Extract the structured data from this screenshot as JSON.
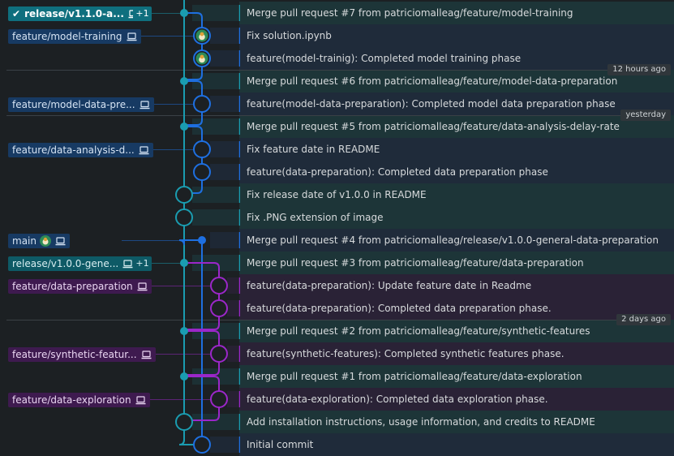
{
  "colors": {
    "background": "#1c2023",
    "lane_teal": "#1a9cb0",
    "lane_blue": "#1e6fe0",
    "lane_purple": "#9b27c9",
    "pill_teal_bg": "#0e5a66",
    "pill_blue_bg": "#173a63",
    "pill_purple_bg": "#3e1a4f"
  },
  "time_markers": [
    {
      "label": "12 hours ago",
      "after_row": 2
    },
    {
      "label": "yesterday",
      "after_row": 4
    },
    {
      "label": "2 days ago",
      "after_row": 13
    }
  ],
  "commits": [
    {
      "message": "Merge pull request #7 from patriciomalleag/feature/model-training",
      "lane": "teal",
      "kind": "merge",
      "branch": {
        "label": "release/v1.1.0-a...",
        "style": "teal-active",
        "checked": true,
        "icon": "laptop-icon",
        "extra": "+1"
      }
    },
    {
      "message": "Fix solution.ipynb",
      "lane": "blue",
      "kind": "avatar",
      "branch": {
        "label": "feature/model-training",
        "style": "blue",
        "icon": "laptop-icon"
      }
    },
    {
      "message": "feature(model-trainig): Completed model training phase",
      "lane": "blue",
      "kind": "avatar"
    },
    {
      "message": "Merge pull request #6 from patriciomalleag/feature/model-data-preparation",
      "lane": "teal",
      "kind": "merge"
    },
    {
      "message": "feature(model-data-preparation): Completed model data preparation phase",
      "lane": "blue",
      "kind": "circle",
      "branch": {
        "label": "feature/model-data-pre...",
        "style": "blue",
        "icon": "laptop-icon"
      }
    },
    {
      "message": "Merge pull request #5 from patriciomalleag/feature/data-analysis-delay-rate",
      "lane": "teal",
      "kind": "merge"
    },
    {
      "message": "Fix feature date in README",
      "lane": "blue",
      "kind": "circle",
      "branch": {
        "label": "feature/data-analysis-d...",
        "style": "blue",
        "icon": "laptop-icon"
      }
    },
    {
      "message": "feature(data-preparation): Completed data preparation phase",
      "lane": "blue",
      "kind": "circle"
    },
    {
      "message": "Fix release date of v1.0.0 in README",
      "lane": "teal",
      "kind": "circle"
    },
    {
      "message": "Fix .PNG extension of image",
      "lane": "teal",
      "kind": "circle"
    },
    {
      "message": "Merge pull request #4 from patriciomalleag/release/v1.0.0-general-data-preparation",
      "lane": "blue",
      "kind": "merge",
      "branch": {
        "label": "main",
        "style": "blue",
        "avatar": true,
        "icon": "laptop-icon"
      }
    },
    {
      "message": "Merge pull request #3 from patriciomalleag/feature/data-preparation",
      "lane": "teal",
      "kind": "merge",
      "branch": {
        "label": "release/v1.0.0-gene...",
        "style": "teal",
        "icon": "laptop-icon",
        "extra": "+1"
      }
    },
    {
      "message": "feature(data-preparation): Update feature date in Readme",
      "lane": "purple",
      "kind": "circle",
      "branch": {
        "label": "feature/data-preparation",
        "style": "purple",
        "icon": "laptop-icon"
      }
    },
    {
      "message": "feature(data-preparation): Completed data preparation phase.",
      "lane": "purple",
      "kind": "circle"
    },
    {
      "message": "Merge pull request #2 from patriciomalleag/feature/synthetic-features",
      "lane": "teal",
      "kind": "merge"
    },
    {
      "message": "feature(synthetic-features): Completed synthetic features phase.",
      "lane": "purple",
      "kind": "circle",
      "branch": {
        "label": "feature/synthetic-featur...",
        "style": "purple",
        "icon": "laptop-icon"
      }
    },
    {
      "message": "Merge pull request #1 from patriciomalleag/feature/data-exploration",
      "lane": "teal",
      "kind": "merge"
    },
    {
      "message": "feature(data-exploration): Completed data exploration phase.",
      "lane": "purple",
      "kind": "circle",
      "branch": {
        "label": "feature/data-exploration",
        "style": "purple",
        "icon": "laptop-icon"
      }
    },
    {
      "message": "Add installation instructions, usage information, and credits to README",
      "lane": "teal",
      "kind": "circle"
    },
    {
      "message": "Initial commit",
      "lane": "blue",
      "kind": "circle"
    }
  ]
}
